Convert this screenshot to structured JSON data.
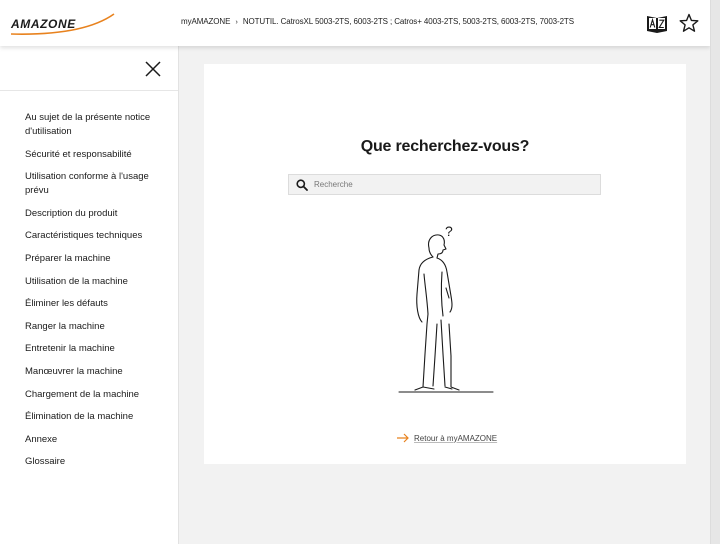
{
  "header": {
    "logo_text": "AMAZONE",
    "breadcrumb": {
      "root": "myAMAZONE",
      "separator": "›",
      "current": "NOTUTIL. CatrosXL 5003-2TS, 6003-2TS ; Catros+ 4003-2TS, 5003-2TS, 6003-2TS, 7003-2TS"
    },
    "icons": [
      "language-icon",
      "star-icon"
    ]
  },
  "sidebar": {
    "close_icon": "close-icon",
    "items": [
      {
        "label": "Au sujet de la présente notice d'utilisation"
      },
      {
        "label": "Sécurité et responsabilité"
      },
      {
        "label": "Utilisation conforme à l'usage prévu"
      },
      {
        "label": "Description du produit"
      },
      {
        "label": "Caractéristiques techniques"
      },
      {
        "label": "Préparer la machine"
      },
      {
        "label": "Utilisation de la machine"
      },
      {
        "label": "Éliminer les défauts"
      },
      {
        "label": "Ranger la machine"
      },
      {
        "label": "Entretenir la machine"
      },
      {
        "label": "Manœuvrer la machine"
      },
      {
        "label": "Chargement de la machine"
      },
      {
        "label": "Élimination de la machine"
      },
      {
        "label": "Annexe"
      },
      {
        "label": "Glossaire"
      }
    ]
  },
  "main": {
    "title": "Que recherchez-vous?",
    "search": {
      "placeholder": "Recherche",
      "value": ""
    },
    "illustration": {
      "question_mark": "?"
    },
    "back_link": "Retour à myAMAZONE"
  },
  "colors": {
    "brand_orange": "#e8821e",
    "logo_text": "#1a1a1a",
    "page_bg": "#f2f2f2",
    "card_bg": "#ffffff"
  }
}
